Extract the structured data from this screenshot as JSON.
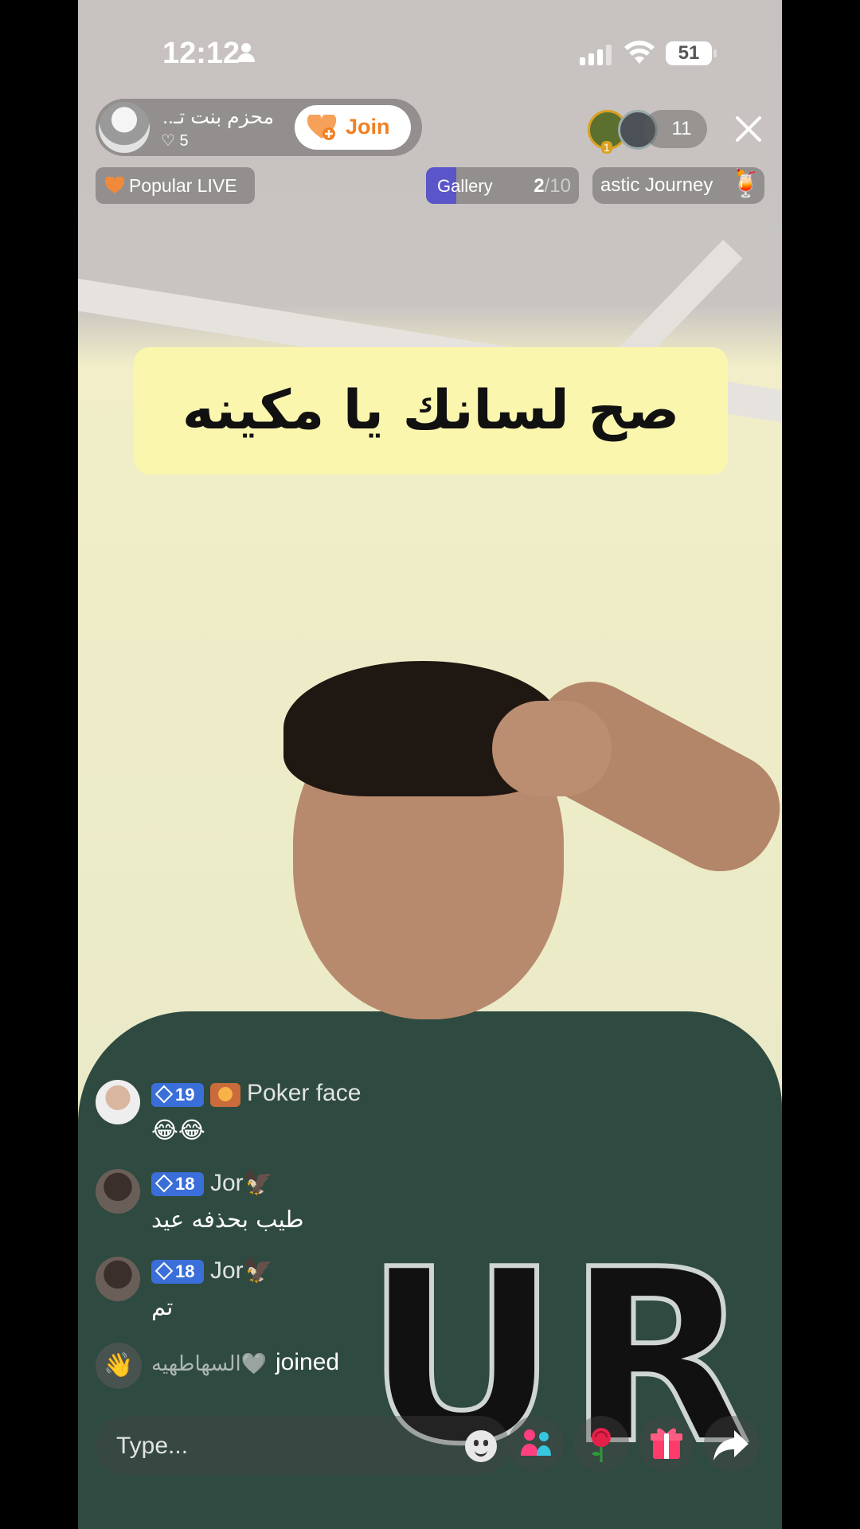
{
  "status_bar": {
    "time": "12:12",
    "battery": "51"
  },
  "host": {
    "name": "محزم بنت تـ...",
    "likes": "♡ 5",
    "join_label": "Join"
  },
  "viewers": {
    "count": "11",
    "top_rank": "1"
  },
  "tags": {
    "popular": "Popular LIVE",
    "gallery_label": "Gallery",
    "gallery_current": "2",
    "gallery_total": "/10",
    "gallery_progress": 0.2,
    "journey": "astic Journey"
  },
  "caption": "صح لسانك يا مكينه",
  "chat": [
    {
      "level": "19",
      "user": "Poker face",
      "text": "😂😂"
    },
    {
      "level": "18",
      "user": "Jor🦅",
      "text": "طيب بحذفه عيد"
    },
    {
      "level": "18",
      "user": "Jor🦅",
      "text": "تم"
    }
  ],
  "join_notice": {
    "user": "السهاطهيه🤍",
    "text": "joined"
  },
  "input": {
    "placeholder": "Type..."
  },
  "colors": {
    "join_accent": "#f08022",
    "level_badge": "#3a6ed9",
    "caption_bg": "#fbf6ae",
    "gallery_fill": "#5a55c8"
  }
}
